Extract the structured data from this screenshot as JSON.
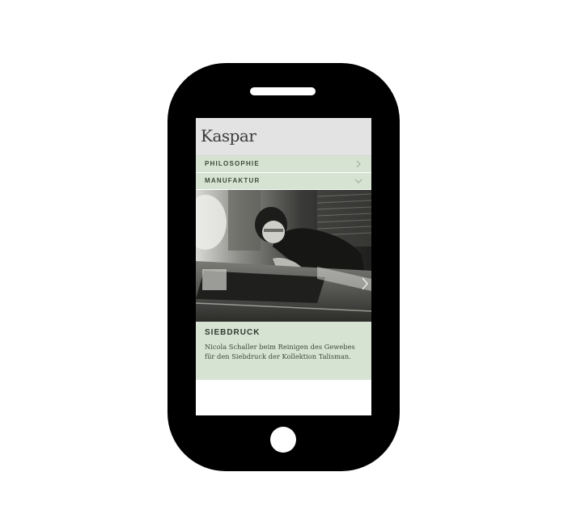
{
  "site": {
    "logo": "Kaspar"
  },
  "nav": {
    "items": [
      {
        "label": "PHILOSOPHIE",
        "icon": "chevron-right-icon"
      },
      {
        "label": "MANUFAKTUR",
        "icon": "chevron-down-icon"
      }
    ]
  },
  "slide": {
    "photo": "screen-printing-workshop-photo",
    "next_icon": "chevron-right-icon",
    "title": "SIEBDRUCK",
    "caption": "Nicola Schaller beim Reinigen des Gewebes für den Siebdruck der Kollektion Talisman."
  },
  "colors": {
    "phone_body": "#000000",
    "header_bg": "#e4e3e3",
    "accent_green": "#d6e3d2",
    "text_dark": "#3a4a3a"
  }
}
